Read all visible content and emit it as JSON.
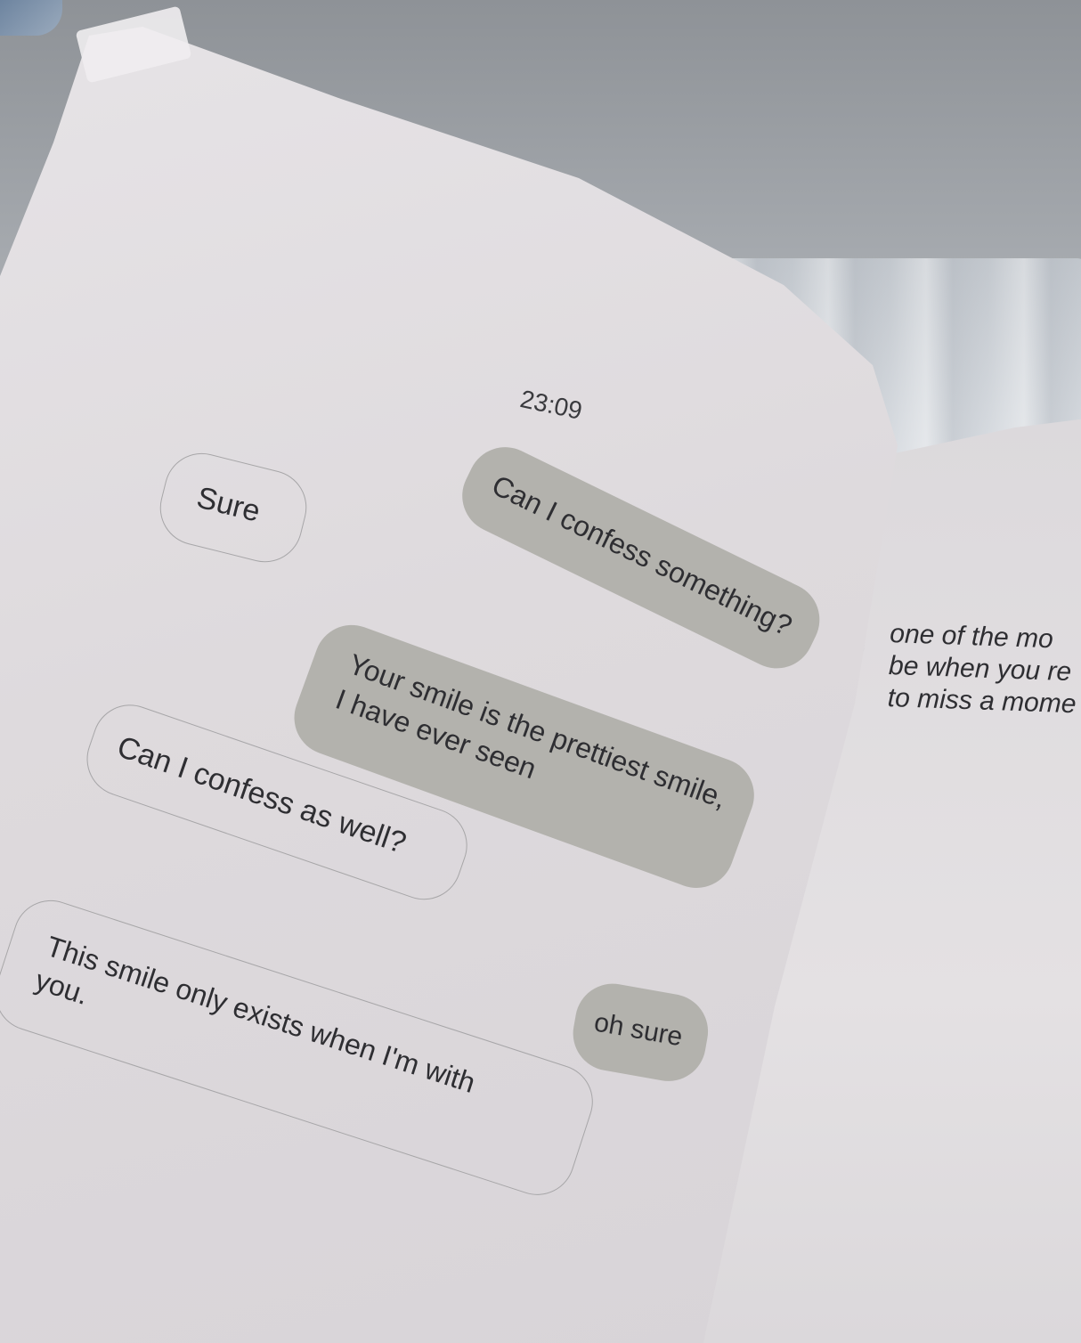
{
  "photo": {
    "timestamp": "23:09",
    "messages": [
      {
        "side": "received",
        "text": "Sure"
      },
      {
        "side": "sent",
        "text": "Can I confess something?"
      },
      {
        "side": "sent",
        "lines": [
          "Your smile is the prettiest smile,",
          "I have ever seen"
        ]
      },
      {
        "side": "received",
        "text": "Can I confess as well?"
      },
      {
        "side": "received",
        "lines": [
          "This smile only exists when I'm with",
          "you."
        ]
      },
      {
        "side": "sent",
        "text": "oh sure"
      }
    ],
    "right_page_lines": [
      "one of the mo",
      "be when you re",
      "to miss a mome"
    ],
    "colors": {
      "page": "#e2dfe2",
      "sent_bubble": "#b3b2ad",
      "received_border": "#a7a6a8",
      "text": "#2e2e32",
      "background": "#a4a8ad"
    }
  }
}
